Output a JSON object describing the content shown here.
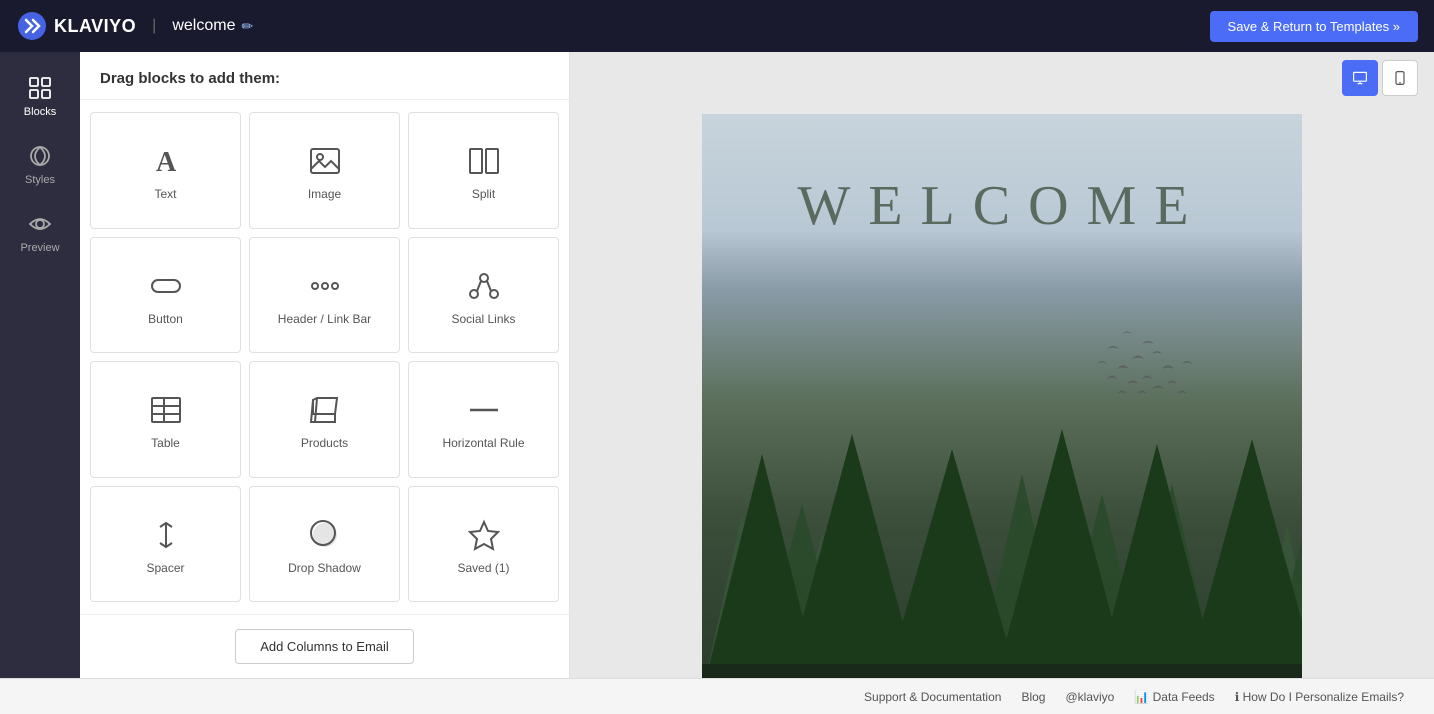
{
  "header": {
    "logo_text": "KLAVIYO",
    "project_name": "welcome",
    "edit_icon": "✏",
    "save_button": "Save & Return to Templates »"
  },
  "sidebar": {
    "items": [
      {
        "id": "blocks",
        "label": "Blocks",
        "active": true
      },
      {
        "id": "styles",
        "label": "Styles",
        "active": false
      },
      {
        "id": "preview",
        "label": "Preview",
        "active": false
      }
    ]
  },
  "block_panel": {
    "header": "Drag blocks to add them:",
    "blocks": [
      {
        "id": "text",
        "label": "Text"
      },
      {
        "id": "image",
        "label": "Image"
      },
      {
        "id": "split",
        "label": "Split"
      },
      {
        "id": "button",
        "label": "Button"
      },
      {
        "id": "header-link-bar",
        "label": "Header / Link Bar"
      },
      {
        "id": "social-links",
        "label": "Social Links"
      },
      {
        "id": "table",
        "label": "Table"
      },
      {
        "id": "products",
        "label": "Products"
      },
      {
        "id": "horizontal-rule",
        "label": "Horizontal Rule"
      },
      {
        "id": "spacer",
        "label": "Spacer"
      },
      {
        "id": "drop-shadow",
        "label": "Drop Shadow"
      },
      {
        "id": "saved",
        "label": "Saved (1)"
      }
    ],
    "add_columns_button": "Add Columns to Email"
  },
  "canvas": {
    "welcome_text": "WELCOME",
    "desktop_view_label": "Desktop view",
    "mobile_view_label": "Mobile view"
  },
  "footer": {
    "support_text": "Support & Documentation",
    "blog_text": "Blog",
    "twitter_text": "@klaviyo",
    "data_feeds_text": "Data Feeds",
    "personalize_text": "How Do I Personalize Emails?"
  }
}
